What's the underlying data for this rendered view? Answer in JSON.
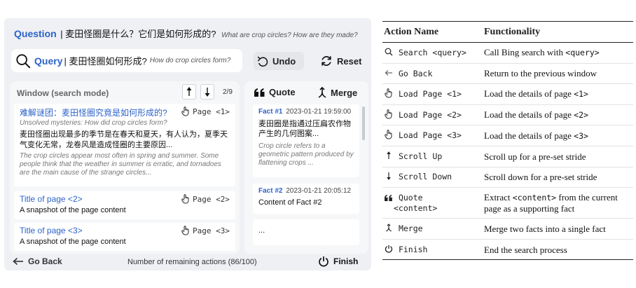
{
  "question": {
    "label": "Question",
    "zh": "| 麦田怪圈是什么？它们是如何形成的?",
    "en": "What are crop circles? How are they made?"
  },
  "query": {
    "label": "Query",
    "zh": "| 麦田怪圈如何形成?",
    "en": "How do crop circles form?"
  },
  "toolbar": {
    "undo_label": "Undo",
    "reset_label": "Reset"
  },
  "window": {
    "title": "Window (search mode)",
    "page_counter": "2/9",
    "results": [
      {
        "title": "难解谜团：麦田怪圈究竟是如何形成的?",
        "load_label": "Page <1>",
        "subtitle": "Unsolved mysteries: How did crop circles form?",
        "body": "麦田怪圈出现最多的季节是在春天和夏天，有人认为，夏季天气变化无常，龙卷风是造成怪圈的主要原因...",
        "body_en": "The crop circles appear most often in spring and summer. Some people think that the weather in summer is erratic, and tornadoes are the main cause of the strange circles..."
      },
      {
        "title": "Title of page <2>",
        "load_label": "Page <2>",
        "snapshot": "A snapshot of the page content"
      },
      {
        "title": "Title of page <3>",
        "load_label": "Page <3>",
        "snapshot": "A snapshot of the page content"
      }
    ]
  },
  "facts": {
    "quote_label": "Quote",
    "merge_label": "Merge",
    "items": [
      {
        "id": "Fact #1",
        "time": "2023-01-21 19:59:00",
        "zh": "麦田圈是指通过压扁农作物产生的几何图案...",
        "en": "Crop circle refers to a geometric pattern produced by flattening crops ..."
      },
      {
        "id": "Fact #2",
        "time": "2023-01-21 20:05:12",
        "content": "Content of Fact #2"
      },
      {
        "content": "..."
      }
    ]
  },
  "bottom": {
    "go_back_label": "Go Back",
    "remaining": "Number of remaining actions (86/100)",
    "finish_label": "Finish"
  },
  "table": {
    "header_name": "Action Name",
    "header_func": "Functionality",
    "rows": [
      {
        "icon": "search-icon",
        "name": "Search <query>",
        "func_pre": "Call Bing search with ",
        "func_code": "<query>",
        "func_post": ""
      },
      {
        "icon": "arrow-left-icon",
        "name": "Go Back",
        "func_pre": "Return to the previous window",
        "func_code": "",
        "func_post": ""
      },
      {
        "icon": "hand-pointer-icon",
        "name": "Load Page <1>",
        "func_pre": "Load the details of  page ",
        "func_code": "<1>",
        "func_post": ""
      },
      {
        "icon": "hand-pointer-icon",
        "name": "Load Page <2>",
        "func_pre": "Load the details of  page ",
        "func_code": "<2>",
        "func_post": ""
      },
      {
        "icon": "hand-pointer-icon",
        "name": "Load Page <3>",
        "func_pre": "Load the details of  page ",
        "func_code": "<3>",
        "func_post": ""
      },
      {
        "icon": "arrow-up-icon",
        "name": "Scroll Up",
        "func_pre": "Scroll up for a pre-set stride",
        "func_code": "",
        "func_post": ""
      },
      {
        "icon": "arrow-down-icon",
        "name": "Scroll Down",
        "func_pre": "Scroll down for a pre-set stride",
        "func_code": "",
        "func_post": ""
      },
      {
        "icon": "quote-icon",
        "name": "Quote",
        "name_line2": "<content>",
        "func_pre": "Extract ",
        "func_code": "<content>",
        "func_post": " from the current page as a supporting fact"
      },
      {
        "icon": "merge-icon",
        "name": "Merge",
        "func_pre": "Merge two facts into a single fact",
        "func_code": "",
        "func_post": ""
      },
      {
        "icon": "power-icon",
        "name": "Finish",
        "func_pre": "End the search process",
        "func_code": "",
        "func_post": ""
      }
    ]
  }
}
